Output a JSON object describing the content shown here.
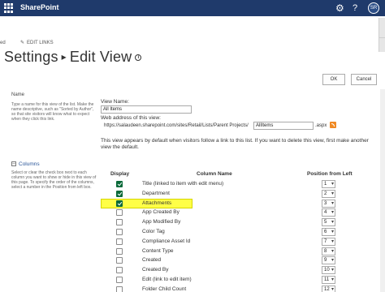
{
  "suitebar": {
    "brand": "SharePoint",
    "help": "?",
    "avatar": "SR"
  },
  "edit": {
    "left_fragment": "ed",
    "edit_links": "EDIT LINKS"
  },
  "title": {
    "settings": "Settings",
    "separator": "▸",
    "edit_view": "Edit View",
    "info": "i"
  },
  "buttons": {
    "ok": "OK",
    "cancel": "Cancel"
  },
  "name_section": {
    "heading": "Name",
    "description": "Type a name for this view of the list. Make the name descriptive, such as \"Sorted by Author\", so that site visitors will know what to expect when they click this link.",
    "view_name_label": "View Name:",
    "view_name_value": "All Items",
    "web_address_label": "Web address of this view:",
    "url_prefix": "https://salaudeen.sharepoint.com/sites/Retail/Lists/Parent Projects/",
    "url_value": "AllItems",
    "url_suffix": ".aspx",
    "default_note": "This view appears by default when visitors follow a link to this list. If you want to delete this view, first make another view the default."
  },
  "columns_section": {
    "toggle": "–",
    "heading": "Columns",
    "description": "Select or clear the check box next to each column you want to show or hide in this view of this page. To specify the order of the columns, select a number in the Position from left box.",
    "headers": {
      "display": "Display",
      "column_name": "Column Name",
      "position": "Position from Left"
    },
    "rows": [
      {
        "name": "Title (linked to item with edit menu)",
        "checked": true,
        "position": "1",
        "highlighted": false
      },
      {
        "name": "Department",
        "checked": true,
        "position": "2",
        "highlighted": false
      },
      {
        "name": "Attachments",
        "checked": true,
        "position": "3",
        "highlighted": true
      },
      {
        "name": "App Created By",
        "checked": false,
        "position": "4",
        "highlighted": false
      },
      {
        "name": "App Modified By",
        "checked": false,
        "position": "5",
        "highlighted": false
      },
      {
        "name": "Color Tag",
        "checked": false,
        "position": "6",
        "highlighted": false
      },
      {
        "name": "Compliance Asset Id",
        "checked": false,
        "position": "7",
        "highlighted": false
      },
      {
        "name": "Content Type",
        "checked": false,
        "position": "8",
        "highlighted": false
      },
      {
        "name": "Created",
        "checked": false,
        "position": "9",
        "highlighted": false
      },
      {
        "name": "Created By",
        "checked": false,
        "position": "10",
        "highlighted": false
      },
      {
        "name": "Edit (link to edit item)",
        "checked": false,
        "position": "11",
        "highlighted": false
      },
      {
        "name": "Folder Child Count",
        "checked": false,
        "position": "12",
        "highlighted": false
      }
    ]
  },
  "colors": {
    "suitebar": "#1f3a6b",
    "checked": "#0b6a3a",
    "highlight": "#ffff47",
    "link": "#2a5699",
    "rss": "#f08a24"
  }
}
